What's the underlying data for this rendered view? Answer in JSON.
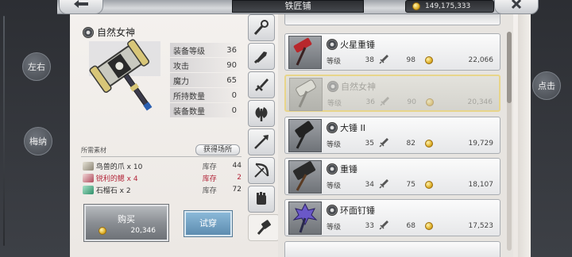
{
  "header": {
    "title": "铁匠铺",
    "gold": "149,175,333",
    "back_icon": "arrow-left-icon",
    "close_icon": "close-x-icon"
  },
  "side": {
    "left_top": "左右",
    "left_bottom": "梅纳",
    "right": "点击"
  },
  "detail": {
    "name": "自然女神",
    "stats": [
      {
        "label": "装备等级",
        "value": "36"
      },
      {
        "label": "攻击",
        "value": "90"
      },
      {
        "label": "魔力",
        "value": "65"
      },
      {
        "label": "所持数量",
        "value": "0"
      },
      {
        "label": "装备数量",
        "value": "0"
      }
    ],
    "materials_title": "所需素材",
    "source_button": "获得场所",
    "materials": [
      {
        "name": "鸟兽的爪 x 10",
        "stock_label": "库存",
        "count": "44",
        "insufficient": false
      },
      {
        "name": "锐利的鳃 x 4",
        "stock_label": "库存",
        "count": "2",
        "insufficient": true
      },
      {
        "name": "石榴石 x 2",
        "stock_label": "库存",
        "count": "72",
        "insufficient": false
      }
    ],
    "buy_label": "购买",
    "buy_price": "20,346",
    "try_label": "试穿"
  },
  "tabs": [
    {
      "icon": "staff-icon"
    },
    {
      "icon": "fist-icon"
    },
    {
      "icon": "sword-icon"
    },
    {
      "icon": "axe-icon"
    },
    {
      "icon": "spear-icon"
    },
    {
      "icon": "bow-icon"
    },
    {
      "icon": "gauntlet-icon"
    },
    {
      "icon": "hammer-icon",
      "active": true
    }
  ],
  "items": [
    {
      "name": "火星重锤",
      "level_label": "等级",
      "level": "38",
      "atk": "98",
      "price": "22,066",
      "selected": false
    },
    {
      "name": "自然女神",
      "level_label": "等级",
      "level": "36",
      "atk": "90",
      "price": "20,346",
      "selected": true
    },
    {
      "name": "大锤 II",
      "level_label": "等级",
      "level": "35",
      "atk": "82",
      "price": "19,729",
      "selected": false
    },
    {
      "name": "重锤",
      "level_label": "等级",
      "level": "34",
      "atk": "75",
      "price": "18,107",
      "selected": false
    },
    {
      "name": "环面钉锤",
      "level_label": "等级",
      "level": "33",
      "atk": "68",
      "price": "17,523",
      "selected": false
    }
  ]
}
